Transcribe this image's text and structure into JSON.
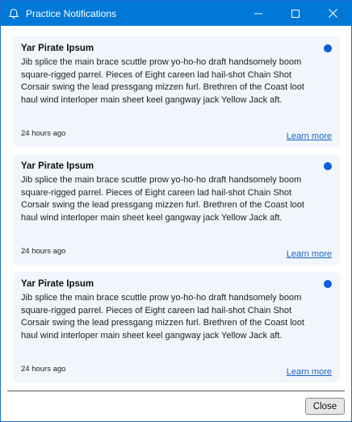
{
  "window": {
    "title": "Practice Notifications",
    "title_icon": "bell-icon",
    "controls": [
      "minimize-icon",
      "maximize-icon",
      "close-icon"
    ]
  },
  "notifications": [
    {
      "title": "Yar Pirate Ipsum",
      "body": "Jib splice the main brace scuttle prow yo-ho-ho draft handsomely boom square-rigged parrel. Pieces of Eight careen lad hail-shot Chain Shot Corsair swing the lead pressgang mizzen furl. Brethren of the Coast loot haul wind interloper main sheet keel gangway jack Yellow Jack aft.",
      "time": "24 hours ago",
      "link": "Learn more",
      "unread": true
    },
    {
      "title": "Yar Pirate Ipsum",
      "body": "Jib splice the main brace scuttle prow yo-ho-ho draft handsomely boom square-rigged parrel. Pieces of Eight careen lad hail-shot Chain Shot Corsair swing the lead pressgang mizzen furl. Brethren of the Coast loot haul wind interloper main sheet keel gangway jack Yellow Jack aft.",
      "time": "24 hours ago",
      "link": "Learn more",
      "unread": true
    },
    {
      "title": "Yar Pirate Ipsum",
      "body": "Jib splice the main brace scuttle prow yo-ho-ho draft handsomely boom square-rigged parrel. Pieces of Eight careen lad hail-shot Chain Shot Corsair swing the lead pressgang mizzen furl. Brethren of the Coast loot haul wind interloper main sheet keel gangway jack Yellow Jack aft.",
      "time": "24 hours ago",
      "link": "Learn more",
      "unread": true
    }
  ],
  "footer": {
    "close_label": "Close"
  },
  "colors": {
    "titlebar": "#0078d7",
    "card_bg": "#f1f5fc",
    "unread_dot": "#0a5fd8",
    "link": "#1b63c6"
  }
}
